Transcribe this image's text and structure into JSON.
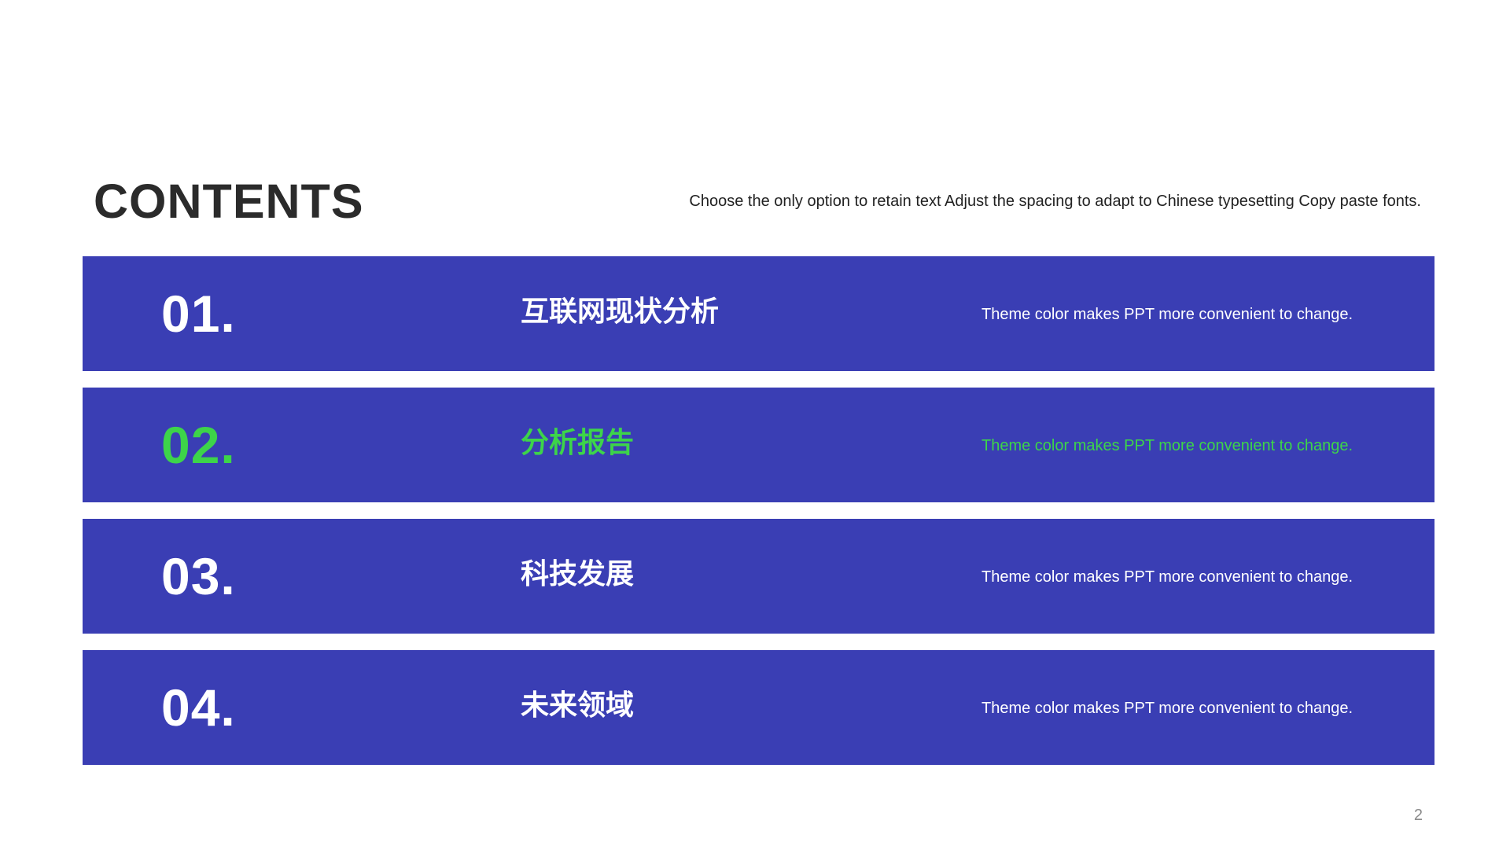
{
  "slide": {
    "title": "CONTENTS",
    "subtitle": "Choose the only option to retain text Adjust the spacing to adapt to Chinese  typesetting Copy paste fonts.",
    "page_number": "2"
  },
  "colors": {
    "row_background": "#3a3eb4",
    "text_default": "#ffffff",
    "text_highlight": "#3dd44a",
    "title": "#2b2b2b"
  },
  "items": [
    {
      "number": "01.",
      "title": "互联网现状分析",
      "description": "Theme  color makes PPT more convenient  to change.",
      "highlighted": false
    },
    {
      "number": "02.",
      "title": "分析报告",
      "description": "Theme  color makes PPT more convenient  to change.",
      "highlighted": true
    },
    {
      "number": "03.",
      "title": "科技发展",
      "description": "Theme  color makes PPT more convenient  to change.",
      "highlighted": false
    },
    {
      "number": "04.",
      "title": "未来领域",
      "description": "Theme  color makes PPT more convenient  to change.",
      "highlighted": false
    }
  ]
}
